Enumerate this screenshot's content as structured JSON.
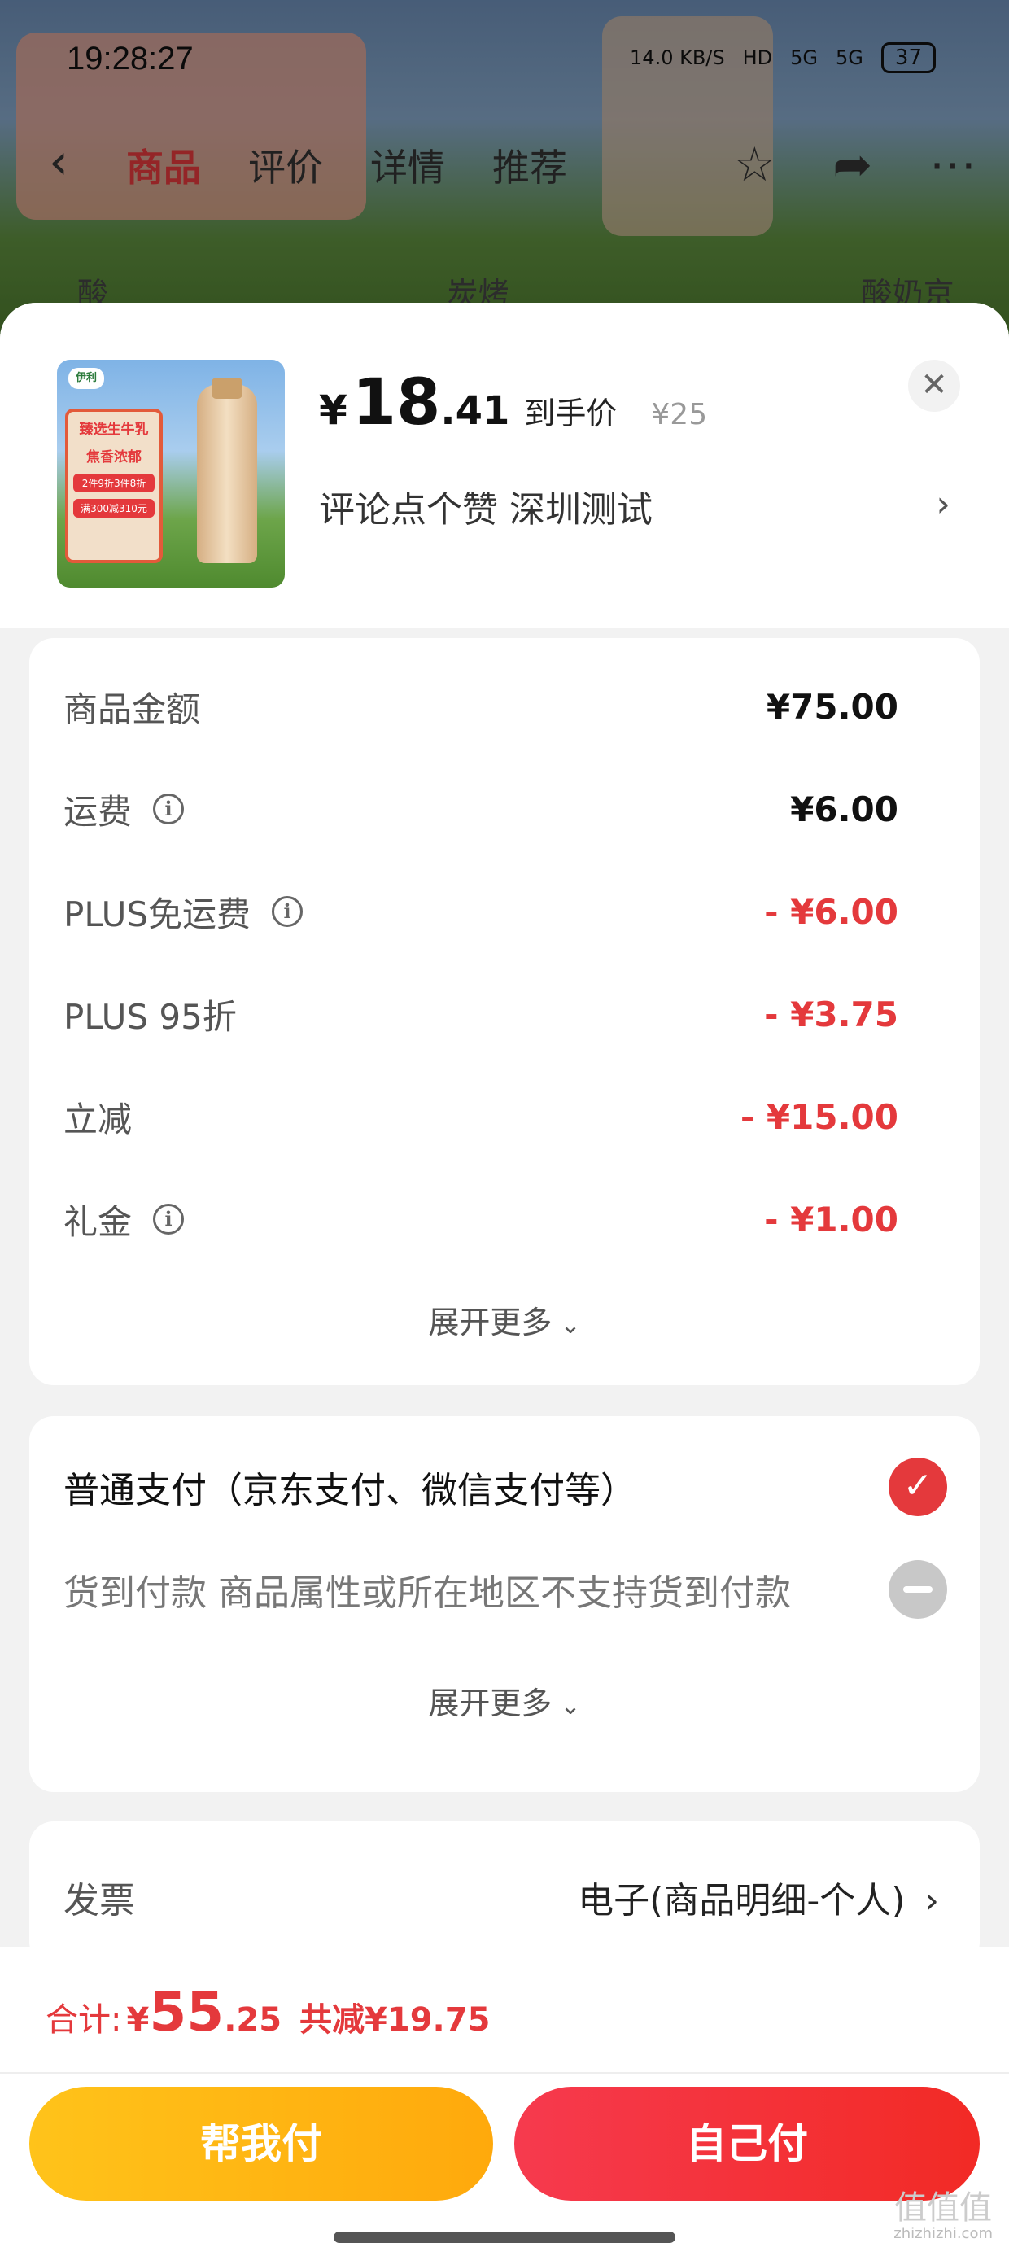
{
  "status_bar": {
    "time": "19:28:27",
    "net_speed": "14.0 KB/S",
    "hd": "HD",
    "signal1": "5G",
    "signal2": "5G",
    "battery": "37"
  },
  "nav": {
    "tabs": [
      "商品",
      "评价",
      "详情",
      "推荐"
    ],
    "active_tab": "商品",
    "search_left": "酸奶",
    "search_mid": "炭烤酸奶",
    "search_right": "酸奶京东自"
  },
  "product": {
    "price_yen": "¥",
    "price_int": "18",
    "price_dec": ".41",
    "price_tag": "到手价",
    "original_price": "¥25",
    "promo_text": "评论点个赞  深圳测试",
    "thumb_logo": "伊利",
    "thumb_banner_1": "臻选生牛乳",
    "thumb_banner_2": "焦香浓郁",
    "thumb_banner_3": "2件9折3件8折",
    "thumb_banner_4": "满300减310元"
  },
  "costs": {
    "rows": [
      {
        "label": "商品金额",
        "info": false,
        "value": "¥75.00",
        "red": false
      },
      {
        "label": "运费",
        "info": true,
        "value": "¥6.00",
        "red": false
      },
      {
        "label": "PLUS免运费",
        "info": true,
        "value": "- ¥6.00",
        "red": true
      },
      {
        "label": "PLUS 95折",
        "info": false,
        "value": "- ¥3.75",
        "red": true
      },
      {
        "label": "立减",
        "info": false,
        "value": "- ¥15.00",
        "red": true
      },
      {
        "label": "礼金",
        "info": true,
        "value": "- ¥1.00",
        "red": true
      }
    ],
    "expand_label": "展开更多"
  },
  "payment": {
    "normal_label": "普通支付（京东支付、微信支付等）",
    "cod_label": "货到付款 商品属性或所在地区不支持货到付款",
    "expand_label": "展开更多"
  },
  "invoice": {
    "label": "发票",
    "value": "电子(商品明细-个人)"
  },
  "bottom": {
    "total_label": "合计:",
    "total_yen": "¥",
    "total_int": "55",
    "total_dec": ".25",
    "total_saved": "共减¥19.75",
    "help_pay_label": "帮我付",
    "self_pay_label": "自己付"
  },
  "watermark": {
    "text": "值值值",
    "sub": "zhizhizhi.com"
  },
  "colors": {
    "accent_red": "#e4393c",
    "help_btn": "#ffb412",
    "self_btn": "#f5333b"
  }
}
